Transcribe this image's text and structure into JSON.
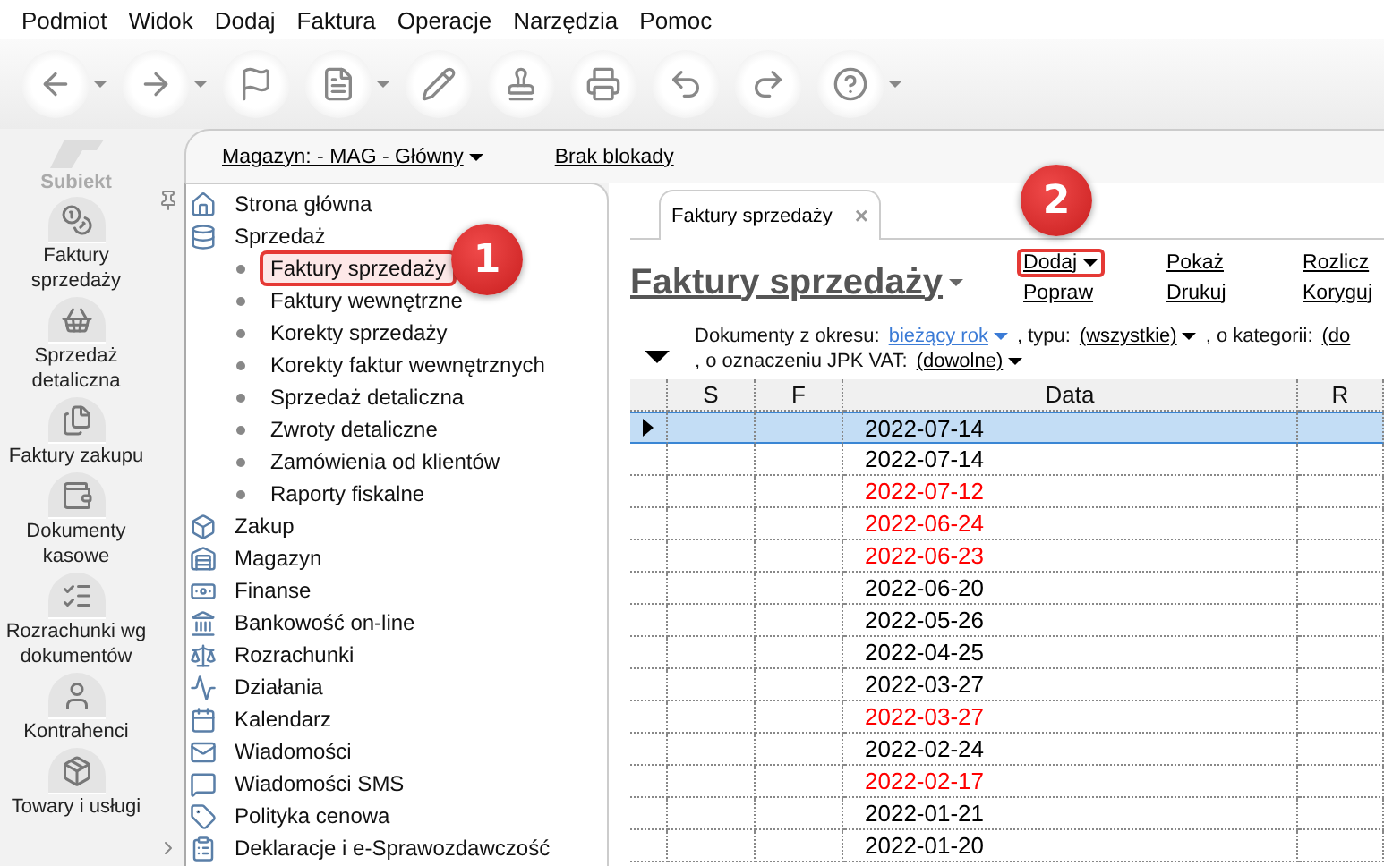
{
  "menu": [
    "Podmiot",
    "Widok",
    "Dodaj",
    "Faktura",
    "Operacje",
    "Narzędzia",
    "Pomoc"
  ],
  "toolbar": [
    {
      "kind": "back",
      "dropdown": true
    },
    {
      "kind": "forward",
      "dropdown": true
    },
    {
      "kind": "flag",
      "dropdown": false
    },
    {
      "kind": "page",
      "dropdown": true
    },
    {
      "kind": "edit",
      "dropdown": false
    },
    {
      "kind": "stamp",
      "dropdown": false
    },
    {
      "kind": "print",
      "dropdown": false
    },
    {
      "kind": "undo",
      "dropdown": false
    },
    {
      "kind": "redo",
      "dropdown": false
    },
    {
      "kind": "help",
      "dropdown": true
    }
  ],
  "logo": {
    "text": "Subiekt"
  },
  "nav": [
    {
      "label": "Faktury sprzedaży"
    },
    {
      "label": "Sprzedaż detaliczna"
    },
    {
      "label": "Faktury zakupu"
    },
    {
      "label": "Dokumenty kasowe"
    },
    {
      "label": "Rozrachunki wg dokumentów"
    },
    {
      "label": "Kontrahenci"
    },
    {
      "label": "Towary i usługi"
    }
  ],
  "header": {
    "warehouse": "Magazyn: - MAG - Główny",
    "lock": "Brak blokady"
  },
  "tree": [
    {
      "label": "Strona główna",
      "selected": false
    },
    {
      "label": "Sprzedaż",
      "selected": false,
      "children": [
        {
          "label": "Faktury sprzedaży",
          "selected": true
        },
        {
          "label": "Faktury wewnętrzne",
          "selected": false
        },
        {
          "label": "Korekty sprzedaży",
          "selected": false
        },
        {
          "label": "Korekty faktur wewnętrznych",
          "selected": false
        },
        {
          "label": "Sprzedaż detaliczna",
          "selected": false
        },
        {
          "label": "Zwroty detaliczne",
          "selected": false
        },
        {
          "label": "Zamówienia od klientów",
          "selected": false
        },
        {
          "label": "Raporty fiskalne",
          "selected": false
        }
      ]
    },
    {
      "label": "Zakup",
      "selected": false
    },
    {
      "label": "Magazyn",
      "selected": false
    },
    {
      "label": "Finanse",
      "selected": false
    },
    {
      "label": "Bankowość on-line",
      "selected": false
    },
    {
      "label": "Rozrachunki",
      "selected": false
    },
    {
      "label": "Działania",
      "selected": false
    },
    {
      "label": "Kalendarz",
      "selected": false
    },
    {
      "label": "Wiadomości",
      "selected": false
    },
    {
      "label": "Wiadomości SMS",
      "selected": false
    },
    {
      "label": "Polityka cenowa",
      "selected": false
    },
    {
      "label": "Deklaracje i e-Sprawozdawczość",
      "selected": false
    }
  ],
  "tab": {
    "label": "Faktury sprzedaży",
    "close": "×"
  },
  "title": "Faktury sprzedaży",
  "actions": [
    {
      "label": "Dodaj",
      "dropdown": true,
      "highlighted": true
    },
    {
      "label": "Popraw",
      "dropdown": false,
      "highlighted": false
    },
    {
      "label": "Pokaż",
      "dropdown": false,
      "highlighted": false
    },
    {
      "label": "Drukuj",
      "dropdown": false,
      "highlighted": false
    },
    {
      "label": "Rozlicz",
      "dropdown": false,
      "highlighted": false
    },
    {
      "label": "Koryguj",
      "dropdown": false,
      "highlighted": false
    }
  ],
  "filters": [
    {
      "text": "Dokumenty z okresu:",
      "value": "bieżący rok",
      "link": true
    },
    {
      "text": ", typu:",
      "value": "(wszystkie)",
      "link": false
    },
    {
      "text": ", o kategorii:",
      "value": "(do",
      "link": false
    },
    {
      "text": ", o oznaczeniu JPK VAT:",
      "value": "(dowolne)",
      "link": false
    }
  ],
  "table": {
    "columns": [
      "S",
      "F",
      "Data",
      "R"
    ],
    "rows": [
      {
        "date": "2022-07-14",
        "color": "#000000",
        "selected": true
      },
      {
        "date": "2022-07-14",
        "color": "#000000",
        "selected": false
      },
      {
        "date": "2022-07-12",
        "color": "#ff0000",
        "selected": false
      },
      {
        "date": "2022-06-24",
        "color": "#ff0000",
        "selected": false
      },
      {
        "date": "2022-06-23",
        "color": "#ff0000",
        "selected": false
      },
      {
        "date": "2022-06-20",
        "color": "#000000",
        "selected": false
      },
      {
        "date": "2022-05-26",
        "color": "#000000",
        "selected": false
      },
      {
        "date": "2022-04-25",
        "color": "#000000",
        "selected": false
      },
      {
        "date": "2022-03-27",
        "color": "#000000",
        "selected": false
      },
      {
        "date": "2022-03-27",
        "color": "#ff0000",
        "selected": false
      },
      {
        "date": "2022-02-24",
        "color": "#000000",
        "selected": false
      },
      {
        "date": "2022-02-17",
        "color": "#ff0000",
        "selected": false
      },
      {
        "date": "2022-01-21",
        "color": "#000000",
        "selected": false
      },
      {
        "date": "2022-01-20",
        "color": "#000000",
        "selected": false
      }
    ]
  },
  "callouts": [
    {
      "label": "1"
    },
    {
      "label": "2"
    }
  ]
}
